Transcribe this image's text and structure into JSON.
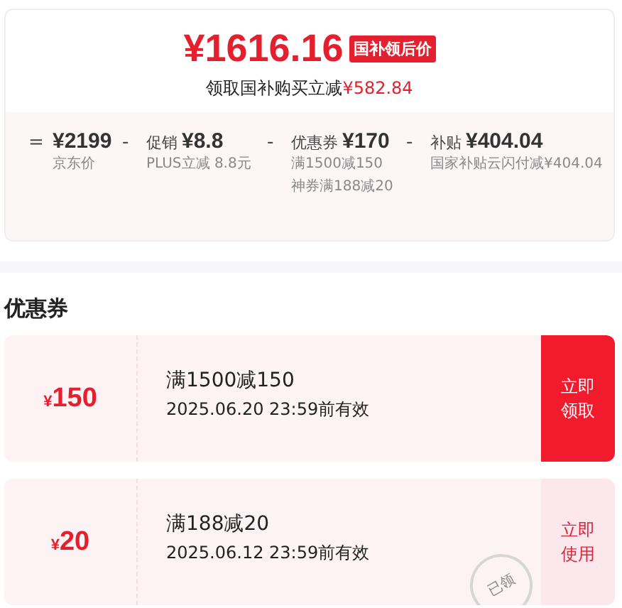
{
  "price": {
    "amount": "¥1616.16",
    "tag": "国补领后价",
    "saving_label": "领取国补购买立减",
    "saving_amount": "¥582.84"
  },
  "breakdown": [
    {
      "op": "=",
      "amount": "¥2199",
      "notes": [
        "京东价"
      ]
    },
    {
      "op": "-",
      "label": "促销",
      "amount": "¥8.8",
      "notes": [
        "PLUS立减 8.8元"
      ]
    },
    {
      "op": "-",
      "label": "优惠券",
      "amount": "¥170",
      "notes": [
        "满1500减150",
        "神券满188减20"
      ]
    },
    {
      "op": "-",
      "label": "补贴",
      "amount": "¥404.04",
      "notes": [
        "国家补贴云闪付减¥404.04"
      ]
    }
  ],
  "coupons_title": "优惠券",
  "coupons": [
    {
      "currency": "¥",
      "amount": "150",
      "condition": "满1500减150",
      "validity": "2025.06.20 23:59前有效",
      "action": "立即领取",
      "claimed": false
    },
    {
      "currency": "¥",
      "amount": "20",
      "condition": "满188减20",
      "validity": "2025.06.12 23:59前有效",
      "action": "立即使用",
      "claimed": true,
      "stamp": "已领"
    }
  ]
}
